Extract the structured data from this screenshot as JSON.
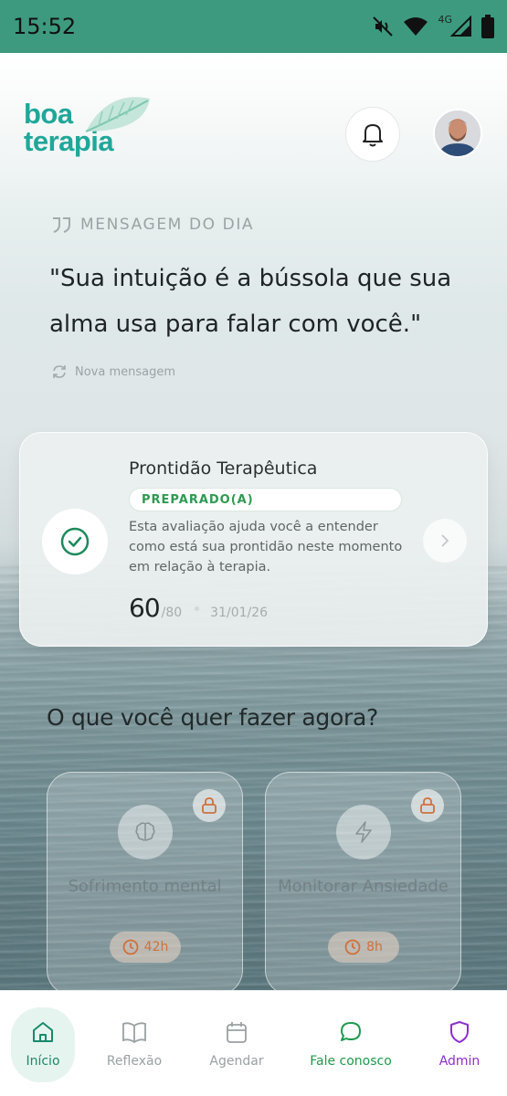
{
  "status_bar": {
    "time": "15:52",
    "network": "4G"
  },
  "header": {
    "logo_line1": "boa",
    "logo_line2": "terapia"
  },
  "motd": {
    "label": "MENSAGEM DO DIA",
    "quote": "\"Sua intuição é a bússola que sua alma usa para falar com você.\"",
    "new_message": "Nova mensagem"
  },
  "readiness_card": {
    "title": "Prontidão Terapêutica",
    "badge": "PREPARADO(A)",
    "description": "Esta avaliação ajuda você a entender como está sua prontidão neste momento em relação à terapia.",
    "score": "60",
    "score_max": "/80",
    "date": "31/01/26"
  },
  "question": "O que você quer fazer agora?",
  "tiles": [
    {
      "title": "Sofrimento mental",
      "time": "42h",
      "icon": "brain-icon",
      "locked": true
    },
    {
      "title": "Monitorar Ansiedade",
      "time": "8h",
      "icon": "lightning-icon",
      "locked": true
    }
  ],
  "bottom_nav": [
    {
      "label": "Início",
      "icon": "home-icon",
      "active": true
    },
    {
      "label": "Reflexão",
      "icon": "book-icon"
    },
    {
      "label": "Agendar",
      "icon": "calendar-icon"
    },
    {
      "label": "Fale conosco",
      "icon": "chat-icon"
    },
    {
      "label": "Admin",
      "icon": "shield-icon"
    }
  ],
  "colors": {
    "status_bar": "#3d9a7f",
    "brand": "#1fa79a",
    "badge_text": "#2e9a52",
    "lock_accent": "#d0703a",
    "admin": "#8b2fd0"
  }
}
